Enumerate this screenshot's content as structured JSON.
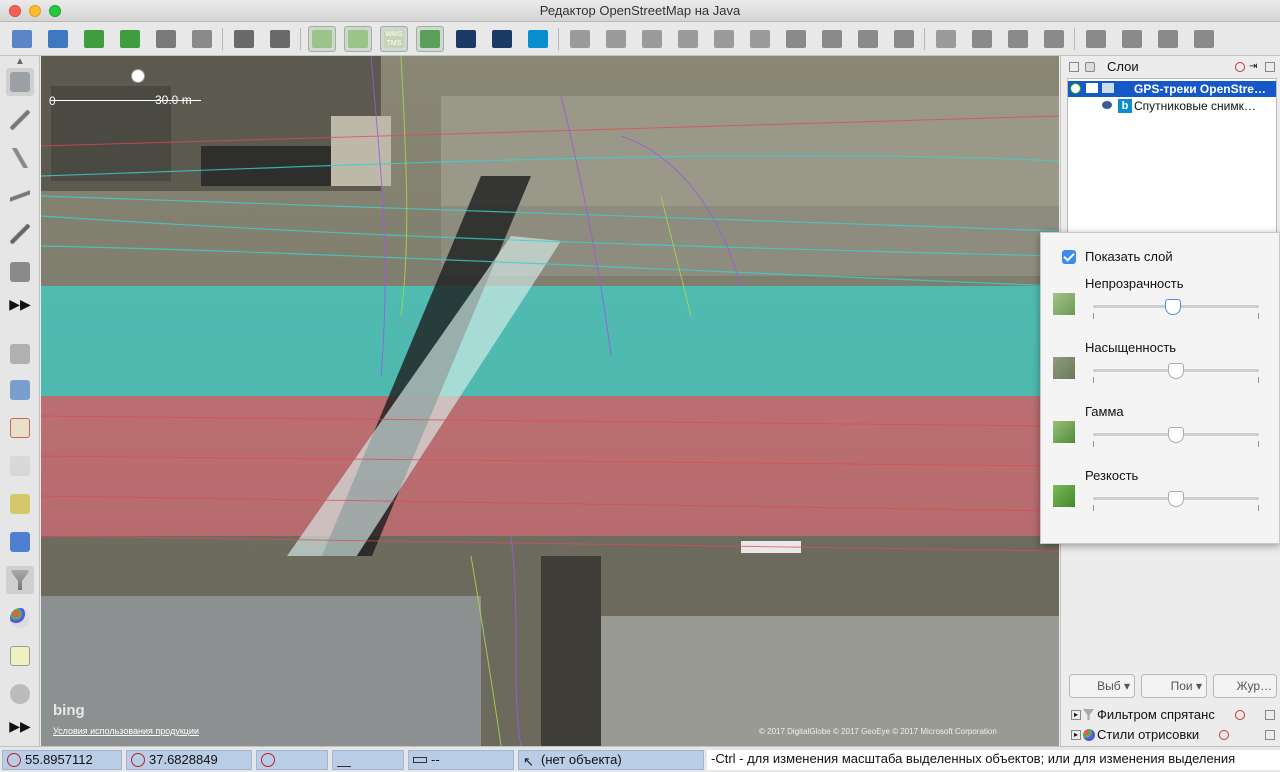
{
  "window": {
    "title": "Редактор OpenStreetMap на Java"
  },
  "toolbar": {
    "buttons": [
      "open-file-icon",
      "save-icon",
      "download-icon",
      "download-data-icon",
      "upload-icon",
      "globe-icon",
      "undo-icon",
      "redo-icon",
      "zoom-to-data-icon",
      "zoom-to-selection-icon",
      "wms-tms-icon",
      "zoom-icon",
      "gps-icon",
      "gps-track-icon",
      "bing-icon",
      "road-icon-1",
      "road-icon-2",
      "road-icon-3",
      "road-icon-4",
      "road-icon-5",
      "road-icon-6",
      "car-icon",
      "bus-icon",
      "bicycle-icon",
      "rail-icon",
      "sign-icon",
      "wheel-icon",
      "bag-icon",
      "cash-icon",
      "factory-icon",
      "mountain-icon",
      "river-icon",
      "castle-icon"
    ],
    "wms_label": "WMS TMS"
  },
  "map": {
    "scale_start": "0",
    "scale_end": "30.0 m",
    "bing_logo": "bing",
    "terms_link": "Условия использования продукции",
    "attribution": "© 2017 DigitalGlobe © 2017 GeoEye © 2017 Microsoft Corporation"
  },
  "layers_panel": {
    "title": "Слои",
    "layers": [
      {
        "name": "GPS-треки OpenStre…",
        "selected": true
      },
      {
        "name": "Спутниковые снимк…",
        "selected": false
      }
    ]
  },
  "panel_buttons": [
    {
      "label": "Выб"
    },
    {
      "label": "Пои"
    },
    {
      "label": "Жур…"
    }
  ],
  "subpanels": [
    {
      "title": "Фильтром спрятанс"
    },
    {
      "title": "Стили отрисовки"
    }
  ],
  "layer_popup": {
    "show_layer": "Показать слой",
    "opacity_label": "Непрозрачность",
    "saturation_label": "Насыщенность",
    "gamma_label": "Гамма",
    "sharpness_label": "Резкость",
    "opacity_value": 0.48,
    "saturation_value": 0.5,
    "gamma_value": 0.5,
    "sharpness_value": 0.5
  },
  "statusbar": {
    "lat": "55.8957112",
    "lon": "37.6828849",
    "heading": "",
    "angle": "",
    "distance": "--",
    "object": "(нет объекта)",
    "help": "-Ctrl - для изменения масштаба выделенных объектов; или для изменения выделения"
  },
  "colors": {
    "selection": "#1559c8",
    "cyan_road": "#3ed3cc",
    "red_road": "#e36a78",
    "status_field": "#b9cde6"
  }
}
